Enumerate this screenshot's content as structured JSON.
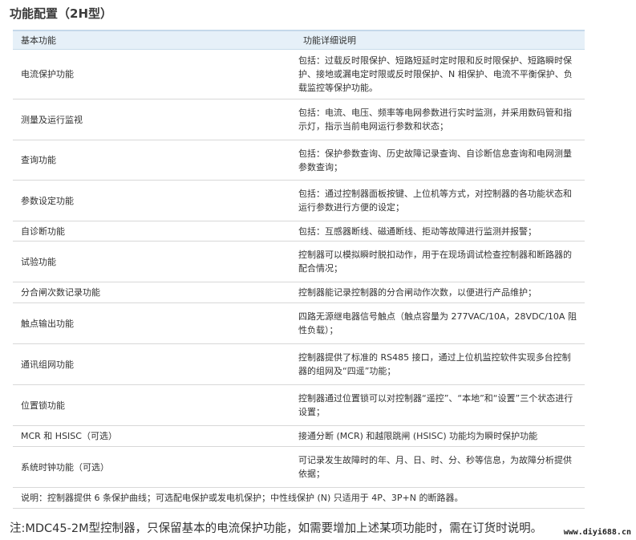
{
  "title": "功能配置（2H型）",
  "table": {
    "headers": [
      "基本功能",
      "功能详细说明"
    ],
    "rows": [
      {
        "feature": "电流保护功能",
        "detail": "包括：过载反时限保护、短路短延时定时限和反时限保护、短路瞬时保护、接地或漏电定时限或反时限保护、N 相保护、电流不平衡保护、负载监控等保护功能。"
      },
      {
        "feature": "测量及运行监视",
        "detail": "包括：电流、电压、频率等电网参数进行实时监测，并采用数码管和指示灯，指示当前电网运行参数和状态；"
      },
      {
        "feature": "查询功能",
        "detail": "包括：保护参数查询、历史故障记录查询、自诊断信息查询和电网测量参数查询；"
      },
      {
        "feature": "参数设定功能",
        "detail": "包括：通过控制器面板按键、上位机等方式，对控制器的各功能状态和运行参数进行方便的设定；"
      },
      {
        "feature": "自诊断功能",
        "detail": "包括：互感器断线、磁通断线、拒动等故障进行监测并报警；"
      },
      {
        "feature": "试验功能",
        "detail": "控制器可以模拟瞬时脱扣动作，用于在现场调试检查控制器和断路器的配合情况；"
      },
      {
        "feature": "分合闸次数记录功能",
        "detail": "控制器能记录控制器的分合闸动作次数，以便进行产品维护；"
      },
      {
        "feature": "触点输出功能",
        "detail": "四路无源继电器信号触点（触点容量为 277VAC/10A，28VDC/10A 阻性负载）；"
      },
      {
        "feature": "通讯组网功能",
        "detail": "控制器提供了标准的 RS485 接口，通过上位机监控软件实现多台控制器的组网及“四遥”功能；"
      },
      {
        "feature": "位置锁功能",
        "detail": "控制器通过位置锁可以对控制器“遥控”、“本地”和“设置”三个状态进行设置；"
      },
      {
        "feature": "MCR 和 HSISC（可选）",
        "detail": "接通分断 (MCR) 和越限跳闸 (HSISC) 功能均为瞬时保护功能"
      },
      {
        "feature": "系统时钟功能（可选）",
        "detail": "可记录发生故障时的年、月、日、时、分、秒等信息，为故障分析提供依据；"
      }
    ],
    "note": "说明：控制器提供 6 条保护曲线；可选配电保护或发电机保护；中性线保护 (N) 只适用于 4P、3P+N 的断路器。"
  },
  "footer": "注:MDC45-2M型控制器，只保留基本的电流保护功能，如需要增加上述某项功能时，需在订货时说明。",
  "watermark": "www.diyi688.cn"
}
